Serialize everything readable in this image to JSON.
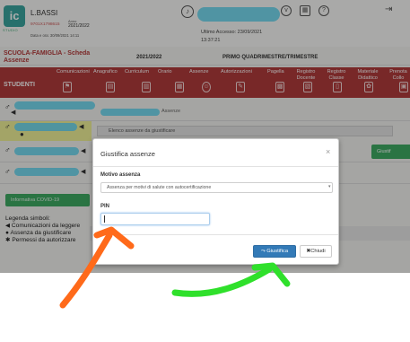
{
  "header": {
    "logo_letters": "ic",
    "logo_sub": "STUDIO",
    "school_name": "L.BASSI",
    "school_code": "9701X1798615",
    "anno_label": "Anno",
    "anno_value": "2021/2022",
    "date_line": "Data e ora: 30/09/2021 14:11",
    "last_access": "Ultimo Accesso: 23/09/2021",
    "last_access_time": "13:37:21"
  },
  "title_bar": {
    "section": "SCUOLA-FAMIGLIA - Scheda Assenze",
    "year": "2021/2022",
    "term": "PRIMO QUADRIMESTRE/TRIMESTRE"
  },
  "nav": {
    "students_label": "STUDENTI",
    "items": [
      {
        "label": "Comunicazioni"
      },
      {
        "label": "Anagrafico"
      },
      {
        "label": "Curriculum"
      },
      {
        "label": "Orario"
      },
      {
        "label": "Assenze"
      },
      {
        "label": "Autorizzazioni"
      },
      {
        "label": "Pagella"
      },
      {
        "label": "Registro Docente"
      },
      {
        "label": "Registro Classe"
      },
      {
        "label": "Materiale Didattico"
      },
      {
        "label": "Prenota Collo"
      }
    ]
  },
  "rows": {
    "assenze_label": "Assenze",
    "tooltip": "Elenco assenze da giustificare",
    "justify_button": "Giustif",
    "covid_button": "Informativa COVID-19"
  },
  "legend": {
    "title": "Legenda simboli:",
    "items": [
      "Comunicazioni da leggere",
      "Assenza da giustificare",
      "Permessi da autorizzare"
    ]
  },
  "modal": {
    "title": "Giustifica assenze",
    "close_glyph": "×",
    "reason_label": "Motivo assenza",
    "reason_selected": "Assenza per motivi di salute con autocertificazione",
    "pin_label": "PIN",
    "pin_value": "",
    "confirm_label": "Giustifica",
    "cancel_label": "Chiudi"
  },
  "colors": {
    "brand_red": "#b23b3b",
    "primary_blue": "#337ab7",
    "success_green": "#3eab63",
    "arrow_orange": "#ff6a1a",
    "arrow_green": "#2fe02b",
    "redaction_cyan": "#6fd8ef"
  }
}
